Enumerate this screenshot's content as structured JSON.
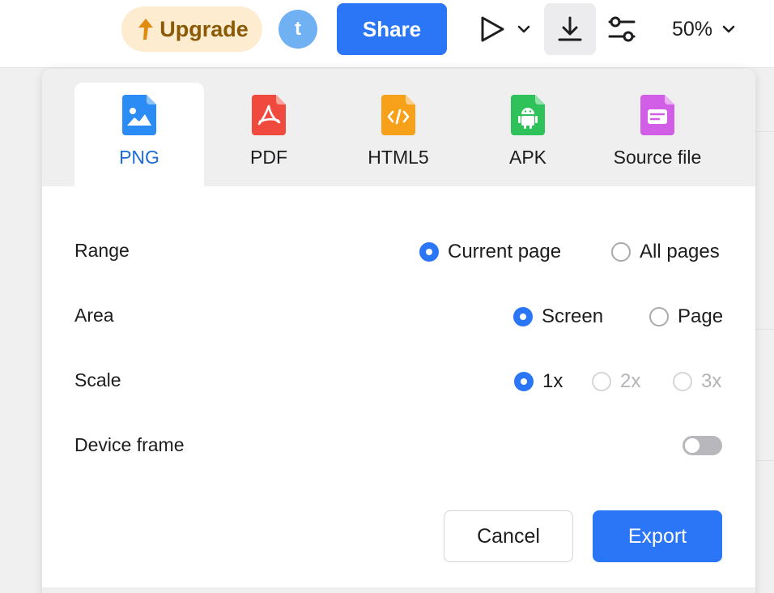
{
  "toolbar": {
    "upgrade_label": "Upgrade",
    "avatar_initial": "t",
    "share_label": "Share",
    "zoom_value": "50%"
  },
  "export_dialog": {
    "tabs": [
      {
        "label": "PNG",
        "icon": "image-file-icon",
        "color": "#2b8cf5",
        "active": true
      },
      {
        "label": "PDF",
        "icon": "pdf-file-icon",
        "color": "#f04a3e",
        "active": false
      },
      {
        "label": "HTML5",
        "icon": "code-file-icon",
        "color": "#f7a11b",
        "active": false
      },
      {
        "label": "APK",
        "icon": "android-file-icon",
        "color": "#2fc25b",
        "active": false
      },
      {
        "label": "Source file",
        "icon": "document-file-icon",
        "color": "#d25ee8",
        "active": false
      }
    ],
    "range": {
      "label": "Range",
      "options": [
        "Current page",
        "All pages"
      ],
      "selected": "Current page"
    },
    "area": {
      "label": "Area",
      "options": [
        "Screen",
        "Page"
      ],
      "selected": "Screen"
    },
    "scale": {
      "label": "Scale",
      "options": [
        "1x",
        "2x",
        "3x"
      ],
      "selected": "1x",
      "disabled": [
        "2x",
        "3x"
      ]
    },
    "device_frame": {
      "label": "Device frame",
      "enabled": false
    },
    "cancel_label": "Cancel",
    "export_label": "Export"
  },
  "colors": {
    "accent": "#2b76f6",
    "active_tab_text": "#1f6bd8",
    "upgrade_bg": "#fdecd0",
    "upgrade_text": "#8a5a06"
  }
}
